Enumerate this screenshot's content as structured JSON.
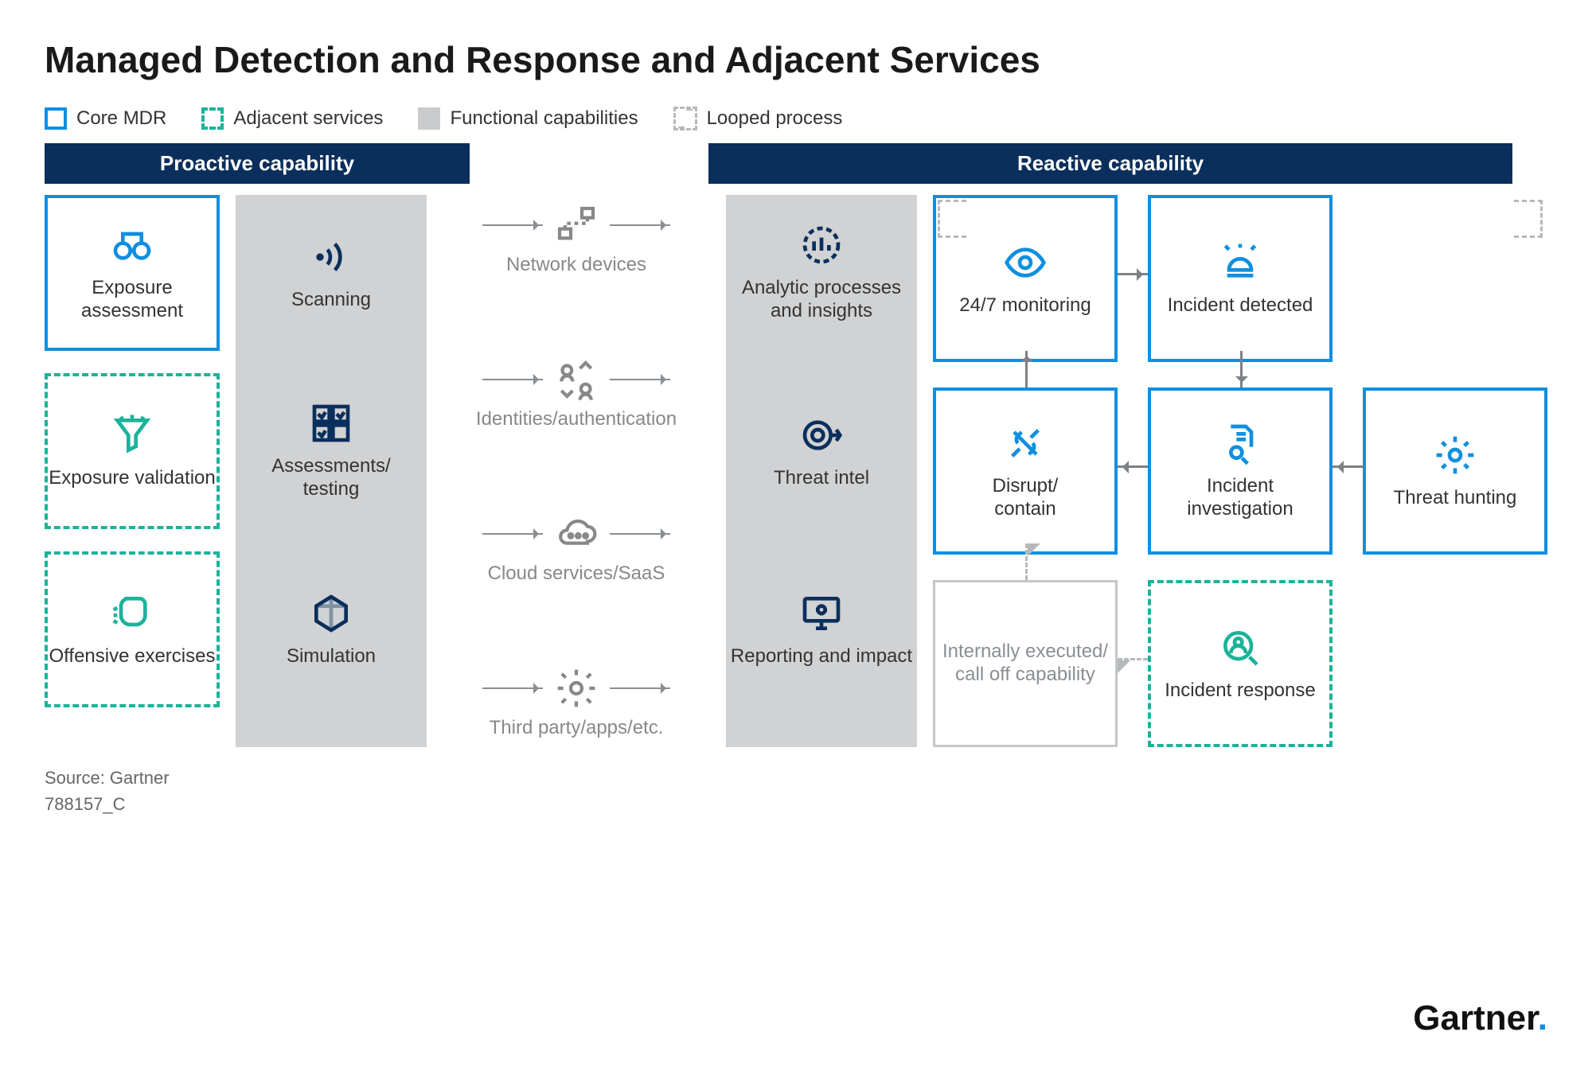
{
  "title": "Managed Detection and Response and Adjacent Services",
  "legend": {
    "core": "Core MDR",
    "adjacent": "Adjacent services",
    "functional": "Functional capabilities",
    "looped": "Looped process"
  },
  "headers": {
    "proactive": "Proactive capability",
    "reactive": "Reactive capability"
  },
  "proactive_boxes": {
    "exposure_assessment": "Exposure assessment",
    "exposure_validation": "Exposure validation",
    "offensive_exercises": "Offensive exercises"
  },
  "proactive_func": {
    "scanning": "Scanning",
    "assessments": "Assessments/\ntesting",
    "simulation": "Simulation"
  },
  "flow_items": {
    "network": "Network devices",
    "identities": "Identities/authentication",
    "cloud": "Cloud services/SaaS",
    "third_party": "Third party/apps/etc."
  },
  "reactive_func": {
    "analytics": "Analytic processes and insights",
    "threat_intel": "Threat intel",
    "reporting": "Reporting and impact"
  },
  "reactive_boxes": {
    "monitoring": "24/7 monitoring",
    "incident_detected": "Incident detected",
    "disrupt": "Disrupt/\ncontain",
    "investigation": "Incident investigation",
    "threat_hunting": "Threat hunting",
    "internally": "Internally executed/\ncall off capability",
    "incident_response": "Incident response"
  },
  "footer": {
    "source": "Source: Gartner",
    "id": "788157_C"
  },
  "brand": "Gartner",
  "colors": {
    "core": "#0f8fe0",
    "adjacent": "#1bb39a",
    "func_bg": "#d0d2d4",
    "header_bg": "#0a2f5c",
    "gray": "#8a8e92",
    "navy": "#0a2f5c"
  }
}
